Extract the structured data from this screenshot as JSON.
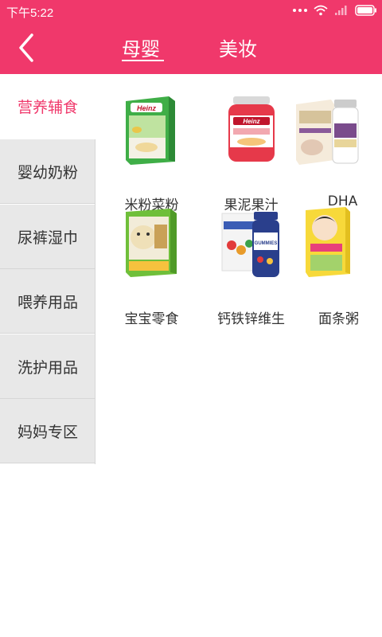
{
  "status": {
    "time": "下午5:22"
  },
  "tabs": [
    {
      "label": "母婴"
    },
    {
      "label": "美妆"
    }
  ],
  "sidebar": {
    "items": [
      {
        "label": "营养辅食"
      },
      {
        "label": "婴幼奶粉"
      },
      {
        "label": "尿裤湿巾"
      },
      {
        "label": "喂养用品"
      },
      {
        "label": "洗护用品"
      },
      {
        "label": "妈妈专区"
      }
    ]
  },
  "products": [
    {
      "name": "米粉菜粉",
      "pack_text": "Heinz"
    },
    {
      "name": "果泥果汁",
      "pack_text": "Heinz"
    },
    {
      "name": "DHA"
    },
    {
      "name": "宝宝零食"
    },
    {
      "name": "钙铁锌维生",
      "pack_text": "GUMMIES"
    },
    {
      "name": "面条粥"
    }
  ],
  "colors": {
    "accent": "#f0386b",
    "sidebar_bg": "#e8e8e8"
  }
}
